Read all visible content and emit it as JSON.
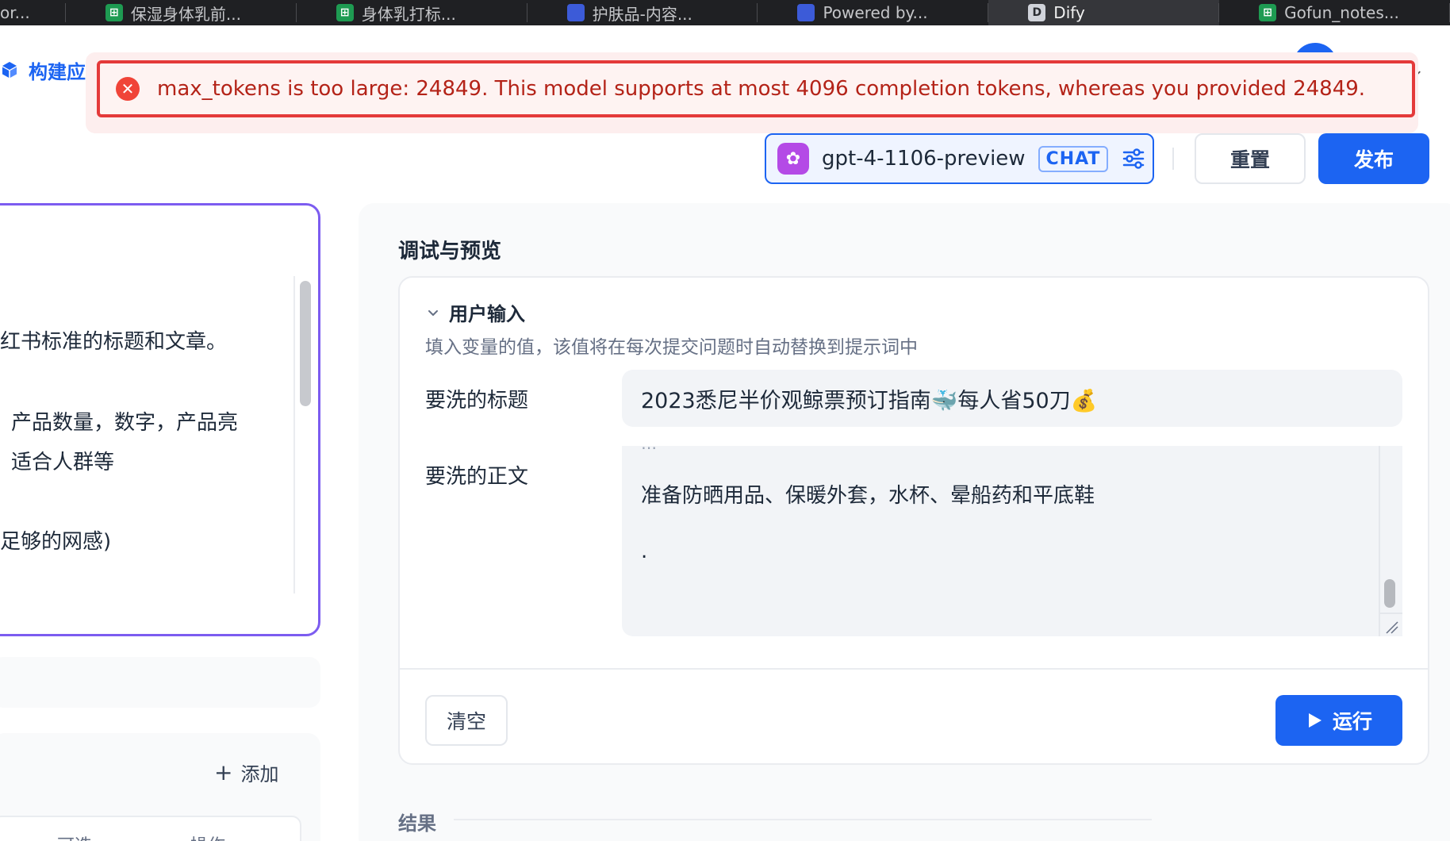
{
  "browser": {
    "tabs": [
      {
        "title": "or...",
        "favicon": ""
      },
      {
        "title": "保湿身体乳前...",
        "favicon": "sheet-icon"
      },
      {
        "title": "身体乳打标...",
        "favicon": "sheet-icon"
      },
      {
        "title": "护肤品-内容...",
        "favicon": "doc-icon"
      },
      {
        "title": "Powered by...",
        "favicon": "doc-icon"
      },
      {
        "title": "Dify",
        "favicon": "dify-icon",
        "active": true
      },
      {
        "title": "Gofun_notes...",
        "favicon": "sheet-icon"
      }
    ],
    "dify_letter": "D"
  },
  "header": {
    "app_title": "构建应用"
  },
  "toast": {
    "type": "error",
    "message": "max_tokens is too large: 24849. This model supports at most 4096 completion tokens, whereas you provided 24849."
  },
  "model": {
    "name": "gpt-4-1106-preview",
    "mode": "CHAT"
  },
  "actions": {
    "reset_label": "重置",
    "publish_label": "发布"
  },
  "prompt": {
    "lines": [
      "红书标准的标题和文章。",
      "产品数量，数字，产品亮",
      "适合人群等",
      "足够的网感)"
    ]
  },
  "left_panel": {
    "add_label": "添加",
    "col_optional": "可选",
    "col_actions": "操作"
  },
  "debug": {
    "title": "调试与预览",
    "user_input_heading": "用户输入",
    "user_input_desc": "填入变量的值，该值将在每次提交问题时自动替换到提示词中",
    "fields": [
      {
        "label": "要洗的标题",
        "value": "2023悉尼半价观鲸票预订指南🐳每人省50刀💰"
      },
      {
        "label": "要洗的正文",
        "value_lines": [
          "准备防晒用品、保暖外套，水杯、晕船药和平底鞋",
          "."
        ]
      }
    ],
    "clear_label": "清空",
    "run_label": "运行",
    "result_label": "结果"
  },
  "colors": {
    "primary": "#1c64f2",
    "error": "#b42318",
    "prompt_border": "#7c5cf0"
  }
}
